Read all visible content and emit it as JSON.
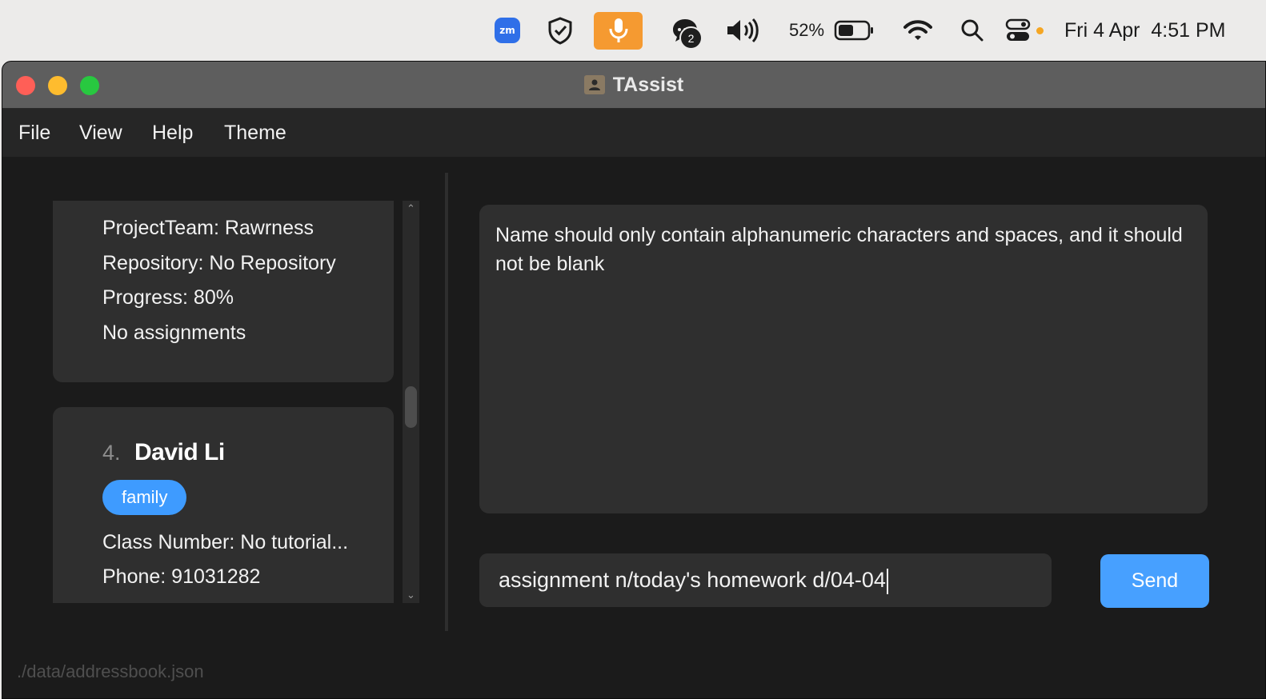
{
  "system_menubar": {
    "zoom_label": "zm",
    "chat_count": "2",
    "battery_percent": "52%",
    "clock": "Fri 4 Apr  4:51 PM",
    "mic_color": "#f59a31",
    "control_center_dot_color": "#f5a623"
  },
  "window": {
    "title": "TAssist"
  },
  "menu": {
    "items": [
      "File",
      "View",
      "Help",
      "Theme"
    ]
  },
  "person_list": {
    "card_3": {
      "project_team": "ProjectTeam: Rawrness",
      "repository": "Repository: No Repository",
      "progress": "Progress: 80%",
      "assignments": "No assignments"
    },
    "card_4": {
      "index": "4.",
      "name": "David Li",
      "tag": "family",
      "class_number": "Class Number: No tutorial...",
      "phone": "Phone: 91031282"
    }
  },
  "result_display": {
    "message": "Name should only contain alphanumeric characters and spaces, and it should not be blank"
  },
  "command_box": {
    "value": "assignment n/today's homework d/04-04",
    "send_label": "Send"
  },
  "status_bar": {
    "save_location": "./data/addressbook.json"
  },
  "colors": {
    "accent": "#47a0ff",
    "tag": "#3e9bff",
    "card": "#2f2f2f",
    "background": "#1b1b1b"
  }
}
